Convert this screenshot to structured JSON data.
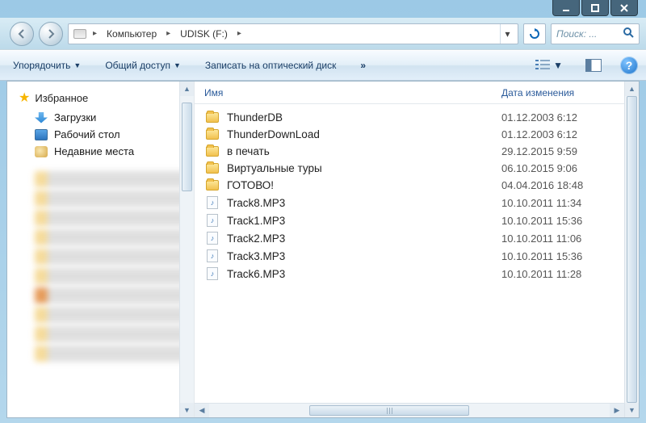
{
  "titlebar": {},
  "breadcrumb": {
    "seg1": "Компьютер",
    "seg2": "UDISK (F:)"
  },
  "search": {
    "placeholder": "Поиск: ..."
  },
  "toolbar": {
    "organize": "Упорядочить",
    "share": "Общий доступ",
    "burn": "Записать на оптический диск",
    "overflow": "»"
  },
  "sidebar": {
    "favorites_label": "Избранное",
    "items": [
      {
        "label": "Загрузки",
        "icon": "downloads"
      },
      {
        "label": "Рабочий стол",
        "icon": "desktop"
      },
      {
        "label": "Недавние места",
        "icon": "recent"
      }
    ]
  },
  "columns": {
    "name": "Имя",
    "date": "Дата изменения"
  },
  "files": [
    {
      "type": "folder",
      "name": "ThunderDB",
      "date": "01.12.2003 6:12"
    },
    {
      "type": "folder",
      "name": "ThunderDownLoad",
      "date": "01.12.2003 6:12"
    },
    {
      "type": "folder",
      "name": "в печать",
      "date": "29.12.2015 9:59"
    },
    {
      "type": "folder",
      "name": "Виртуальные туры",
      "date": "06.10.2015 9:06"
    },
    {
      "type": "folder",
      "name": "ГОТОВО!",
      "date": "04.04.2016 18:48"
    },
    {
      "type": "file",
      "name": "Track8.MP3",
      "date": "10.10.2011 11:34"
    },
    {
      "type": "file",
      "name": "Track1.MP3",
      "date": "10.10.2011 15:36"
    },
    {
      "type": "file",
      "name": "Track2.MP3",
      "date": "10.10.2011 11:06"
    },
    {
      "type": "file",
      "name": "Track3.MP3",
      "date": "10.10.2011 15:36"
    },
    {
      "type": "file",
      "name": "Track6.MP3",
      "date": "10.10.2011 11:28"
    }
  ]
}
